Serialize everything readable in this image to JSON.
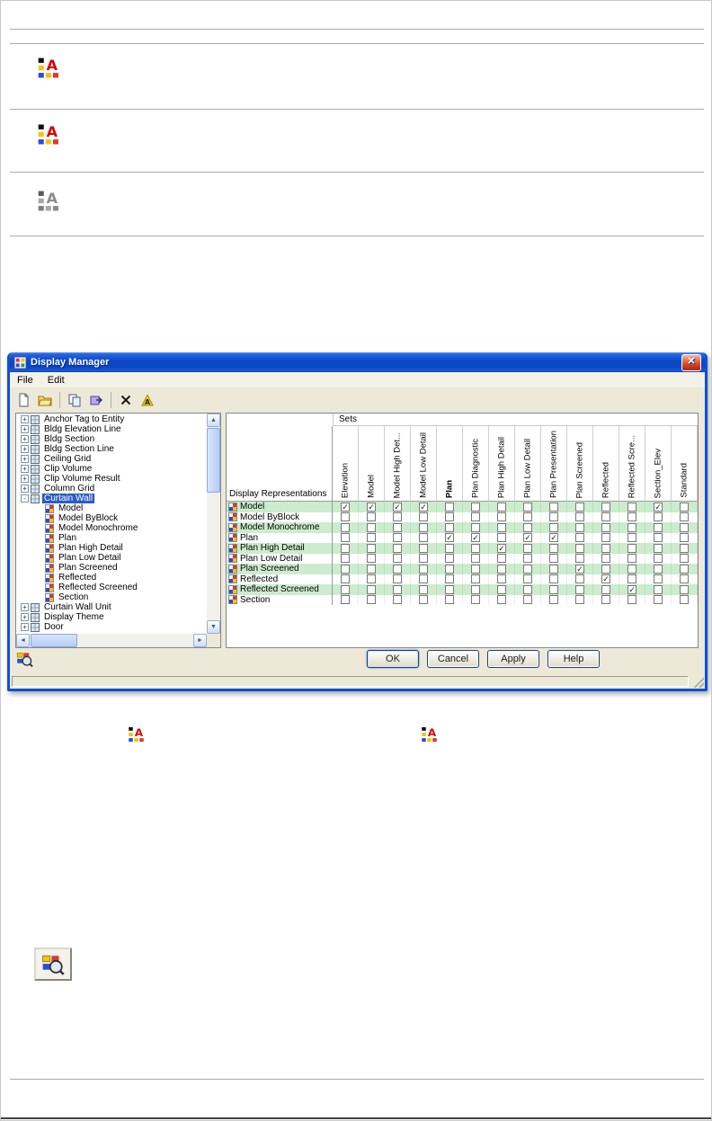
{
  "colors": {
    "titlebar_blue": "#0b47c4",
    "selection_blue": "#2a5cc4",
    "row_green": "#cbeccd",
    "dialog_face": "#ece9d8",
    "close_red": "#c83c18"
  },
  "doc": {
    "icons": [
      "display-representation-set-icon-color",
      "display-representation-set-icon-color",
      "display-representation-set-icon-gray",
      "display-representation-inline-icon-1",
      "display-representation-inline-icon-2",
      "floating-viewer-button-icon"
    ]
  },
  "dialog": {
    "title": "Display Manager",
    "menu": [
      "File",
      "Edit"
    ],
    "toolbar_icons": [
      "new",
      "open",
      "copy",
      "send",
      "delete",
      "purge"
    ],
    "buttons": [
      "OK",
      "Cancel",
      "Apply",
      "Help"
    ],
    "tree": {
      "items": [
        {
          "label": "Anchor Tag to Entity",
          "level": 0,
          "expand": "+"
        },
        {
          "label": "Bldg Elevation Line",
          "level": 0,
          "expand": "+"
        },
        {
          "label": "Bldg Section",
          "level": 0,
          "expand": "+"
        },
        {
          "label": "Bldg Section Line",
          "level": 0,
          "expand": "+"
        },
        {
          "label": "Ceiling Grid",
          "level": 0,
          "expand": "+"
        },
        {
          "label": "Clip Volume",
          "level": 0,
          "expand": "+"
        },
        {
          "label": "Clip Volume Result",
          "level": 0,
          "expand": "+"
        },
        {
          "label": "Column Grid",
          "level": 0,
          "expand": "+"
        },
        {
          "label": "Curtain Wall",
          "level": 0,
          "expand": "-",
          "selected": true
        },
        {
          "label": "Model",
          "level": 1
        },
        {
          "label": "Model ByBlock",
          "level": 1
        },
        {
          "label": "Model Monochrome",
          "level": 1
        },
        {
          "label": "Plan",
          "level": 1
        },
        {
          "label": "Plan High Detail",
          "level": 1
        },
        {
          "label": "Plan Low Detail",
          "level": 1
        },
        {
          "label": "Plan Screened",
          "level": 1
        },
        {
          "label": "Reflected",
          "level": 1
        },
        {
          "label": "Reflected Screened",
          "level": 1
        },
        {
          "label": "Section",
          "level": 1
        },
        {
          "label": "Curtain Wall Unit",
          "level": 0,
          "expand": "+"
        },
        {
          "label": "Display Theme",
          "level": 0,
          "expand": "+"
        },
        {
          "label": "Door",
          "level": 0,
          "expand": "+"
        }
      ]
    },
    "table": {
      "sets_label": "Sets",
      "row_header": "Display Representations",
      "columns": [
        {
          "label": "Elevation"
        },
        {
          "label": "Model"
        },
        {
          "label": "Model High Det..."
        },
        {
          "label": "Model Low Detail"
        },
        {
          "label": "Plan",
          "bold": true
        },
        {
          "label": "Plan Diagnostic"
        },
        {
          "label": "Plan High Detail"
        },
        {
          "label": "Plan Low Detail"
        },
        {
          "label": "Plan Presentation"
        },
        {
          "label": "Plan Screened"
        },
        {
          "label": "Reflected"
        },
        {
          "label": "Reflected Scre..."
        },
        {
          "label": "Section_Elev"
        },
        {
          "label": "Standard"
        }
      ],
      "rows": [
        {
          "label": "Model",
          "checks": [
            1,
            1,
            1,
            1,
            0,
            0,
            0,
            0,
            0,
            0,
            0,
            0,
            1,
            0
          ]
        },
        {
          "label": "Model ByBlock",
          "checks": [
            0,
            0,
            0,
            0,
            0,
            0,
            0,
            0,
            0,
            0,
            0,
            0,
            0,
            0
          ]
        },
        {
          "label": "Model Monochrome",
          "checks": [
            0,
            0,
            0,
            0,
            0,
            0,
            0,
            0,
            0,
            0,
            0,
            0,
            0,
            0
          ]
        },
        {
          "label": "Plan",
          "checks": [
            0,
            0,
            0,
            0,
            1,
            1,
            0,
            1,
            1,
            0,
            0,
            0,
            0,
            0
          ]
        },
        {
          "label": "Plan High Detail",
          "checks": [
            0,
            0,
            0,
            0,
            0,
            0,
            1,
            0,
            0,
            0,
            0,
            0,
            0,
            0
          ]
        },
        {
          "label": "Plan Low Detail",
          "checks": [
            0,
            0,
            0,
            0,
            0,
            0,
            0,
            0,
            0,
            0,
            0,
            0,
            0,
            0
          ]
        },
        {
          "label": "Plan Screened",
          "checks": [
            0,
            0,
            0,
            0,
            0,
            0,
            0,
            0,
            0,
            1,
            0,
            0,
            0,
            0
          ]
        },
        {
          "label": "Reflected",
          "checks": [
            0,
            0,
            0,
            0,
            0,
            0,
            0,
            0,
            0,
            0,
            1,
            0,
            0,
            0
          ]
        },
        {
          "label": "Reflected Screened",
          "checks": [
            0,
            0,
            0,
            0,
            0,
            0,
            0,
            0,
            0,
            0,
            0,
            1,
            0,
            0
          ]
        },
        {
          "label": "Section",
          "checks": [
            0,
            0,
            0,
            0,
            0,
            0,
            0,
            0,
            0,
            0,
            0,
            0,
            0,
            0
          ]
        }
      ]
    }
  }
}
